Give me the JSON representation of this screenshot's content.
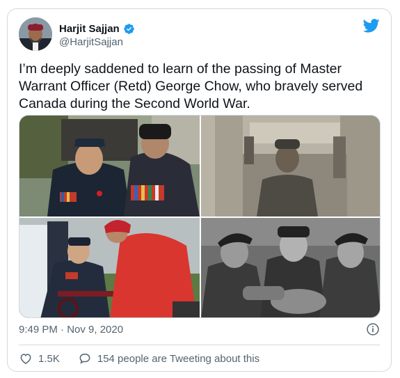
{
  "author": {
    "name": "Harjit Sajjan",
    "handle": "@HarjitSajjan",
    "verified_icon": "verified-badge-icon",
    "avatar_icon": "avatar"
  },
  "tweet": {
    "text": "I’m deeply saddened to learn of the passing of Master Warrant Officer (Retd) George Chow, who bravely served Canada during the Second World War.",
    "timestamp": "9:49 PM · Nov 9, 2020"
  },
  "media": {
    "photos": [
      {
        "name": "photo-veteran-with-medals"
      },
      {
        "name": "photo-soldier-portrait"
      },
      {
        "name": "photo-veteran-in-wheelchair"
      },
      {
        "name": "photo-three-soldiers"
      }
    ]
  },
  "actions": {
    "like_count": "1.5K",
    "reply_label": "154 people are Tweeting about this"
  },
  "colors": {
    "brand": "#1d9bf0",
    "text_secondary": "#536471",
    "border": "#cfd9de"
  },
  "icons": {
    "brand": "twitter-bird-icon",
    "info": "info-icon",
    "like": "heart-icon",
    "reply": "speech-bubble-icon"
  }
}
